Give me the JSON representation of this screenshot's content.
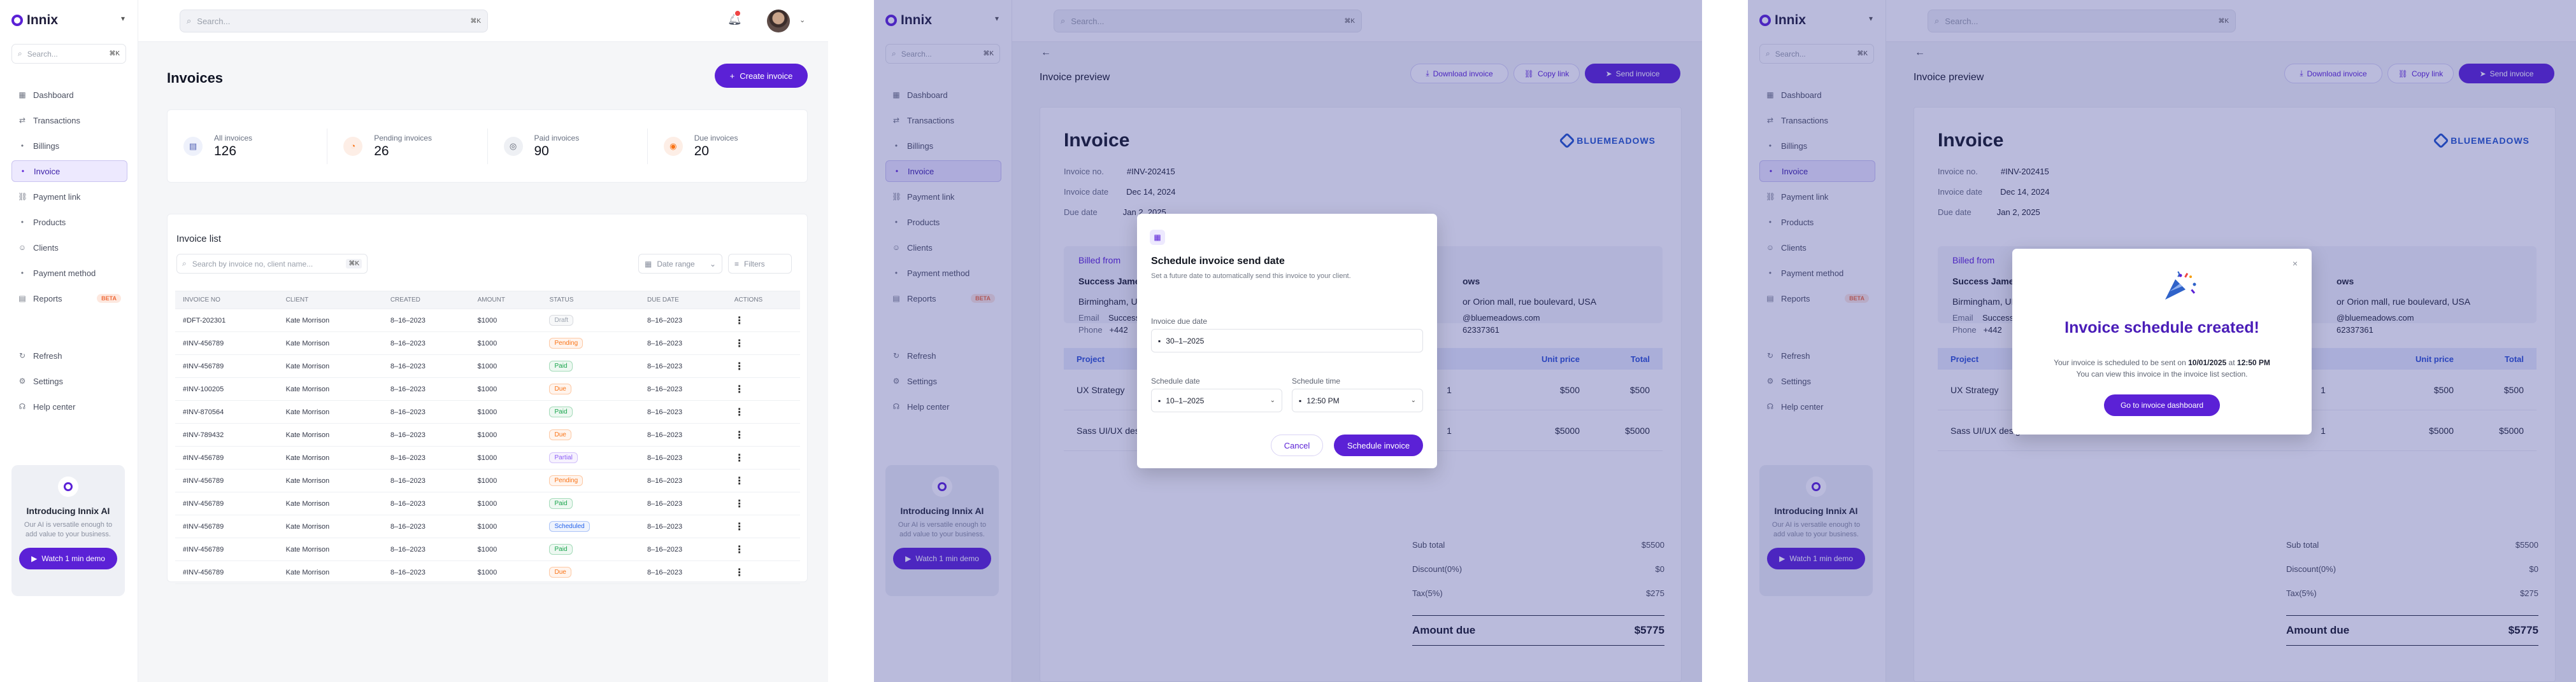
{
  "app": {
    "logo_text": "Innix",
    "search_placeholder": "Search...",
    "search_shortcut": "⌘K"
  },
  "sidebar": {
    "items": [
      {
        "label": "Dashboard",
        "icon": "dashboard-icon"
      },
      {
        "label": "Transactions",
        "icon": "transactions-icon"
      },
      {
        "label": "Billings",
        "icon": "billing-icon"
      },
      {
        "label": "Invoice",
        "icon": "invoice-icon",
        "active": true
      },
      {
        "label": "Payment link",
        "icon": "link-icon"
      },
      {
        "label": "Products",
        "icon": "products-icon"
      },
      {
        "label": "Clients",
        "icon": "clients-icon"
      },
      {
        "label": "Payment method",
        "icon": "payment-method-icon"
      },
      {
        "label": "Reports",
        "icon": "reports-icon",
        "badge": "BETA"
      }
    ],
    "bottom": [
      {
        "label": "Refresh",
        "icon": "refresh-icon"
      },
      {
        "label": "Settings",
        "icon": "settings-icon"
      },
      {
        "label": "Help center",
        "icon": "help-icon"
      }
    ],
    "promo": {
      "title": "Introducing Innix AI",
      "text": "Our AI is versatile enough to add value to your business.",
      "button": "Watch 1 min demo"
    }
  },
  "invoices_page": {
    "title": "Invoices",
    "create_button": "Create invoice",
    "stats": [
      {
        "label": "All invoices",
        "value": "126",
        "icon": "file-icon"
      },
      {
        "label": "Pending invoices",
        "value": "26",
        "icon": "pending-icon"
      },
      {
        "label": "Paid invoices",
        "value": "90",
        "icon": "paid-icon"
      },
      {
        "label": "Due invoices",
        "value": "20",
        "icon": "due-icon"
      }
    ],
    "list_title": "Invoice list",
    "list_search_placeholder": "Search by invoice no, client name...",
    "list_search_shortcut": "⌘K",
    "date_range": "Date range",
    "filters": "Filters",
    "columns": [
      "INVOICE NO",
      "CLIENT",
      "CREATED",
      "AMOUNT",
      "STATUS",
      "DUE DATE",
      "ACTIONS"
    ],
    "rows": [
      {
        "no": "#DFT-202301",
        "client": "Kate Morrison",
        "created": "8–16–2023",
        "amount": "$1000",
        "status": "Draft",
        "due": "8–16–2023"
      },
      {
        "no": "#INV-456789",
        "client": "Kate Morrison",
        "created": "8–16–2023",
        "amount": "$1000",
        "status": "Pending",
        "due": "8–16–2023"
      },
      {
        "no": "#INV-456789",
        "client": "Kate Morrison",
        "created": "8–16–2023",
        "amount": "$1000",
        "status": "Paid",
        "due": "8–16–2023"
      },
      {
        "no": "#INV-100205",
        "client": "Kate Morrison",
        "created": "8–16–2023",
        "amount": "$1000",
        "status": "Due",
        "due": "8–16–2023"
      },
      {
        "no": "#INV-870564",
        "client": "Kate Morrison",
        "created": "8–16–2023",
        "amount": "$1000",
        "status": "Paid",
        "due": "8–16–2023"
      },
      {
        "no": "#INV-789432",
        "client": "Kate Morrison",
        "created": "8–16–2023",
        "amount": "$1000",
        "status": "Due",
        "due": "8–16–2023"
      },
      {
        "no": "#INV-456789",
        "client": "Kate Morrison",
        "created": "8–16–2023",
        "amount": "$1000",
        "status": "Partial",
        "due": "8–16–2023"
      },
      {
        "no": "#INV-456789",
        "client": "Kate Morrison",
        "created": "8–16–2023",
        "amount": "$1000",
        "status": "Pending",
        "due": "8–16–2023"
      },
      {
        "no": "#INV-456789",
        "client": "Kate Morrison",
        "created": "8–16–2023",
        "amount": "$1000",
        "status": "Paid",
        "due": "8–16–2023"
      },
      {
        "no": "#INV-456789",
        "client": "Kate Morrison",
        "created": "8–16–2023",
        "amount": "$1000",
        "status": "Scheduled",
        "due": "8–16–2023"
      },
      {
        "no": "#INV-456789",
        "client": "Kate Morrison",
        "created": "8–16–2023",
        "amount": "$1000",
        "status": "Paid",
        "due": "8–16–2023"
      },
      {
        "no": "#INV-456789",
        "client": "Kate Morrison",
        "created": "8–16–2023",
        "amount": "$1000",
        "status": "Due",
        "due": "8–16–2023"
      }
    ],
    "status_colors": {
      "Draft": "#9ca3af",
      "Pending": "#f97316",
      "Paid": "#16a34a",
      "Due": "#f97316",
      "Partial": "#8b5cf6",
      "Scheduled": "#2563eb"
    }
  },
  "preview": {
    "title": "Invoice preview",
    "download": "Download invoice",
    "copy_link": "Copy link",
    "send": "Send invoice",
    "invoice_heading": "Invoice",
    "brand": "BLUEMEADOWS",
    "invoice_no_label": "Invoice no.",
    "invoice_no": "#INV-202415",
    "invoice_date_label": "Invoice date",
    "invoice_date": "Dec 14, 2024",
    "due_date_label": "Due date",
    "due_date": "Jan 2, 2025",
    "billed_from": "Billed from",
    "company": "Success James",
    "address": "Birmingham, UK",
    "email_label": "Email",
    "email": "Success",
    "phone_label": "Phone",
    "phone": "+442",
    "right_name": "ows",
    "right_address": "or Orion mall, rue boulevard, USA",
    "right_email": "@bluemeadows.com",
    "right_phone": "62337361",
    "columns": [
      "Project",
      "",
      "Unit price",
      "Total"
    ],
    "items": [
      {
        "project": "UX Strategy",
        "qty": "1",
        "price": "$500",
        "total": "$500"
      },
      {
        "project": "Sass UI/UX design",
        "qty": "1",
        "price": "$5000",
        "total": "$5000"
      }
    ],
    "subtotal_label": "Sub total",
    "subtotal": "$5500",
    "discount_label": "Discount(0%)",
    "discount": "$0",
    "tax_label": "Tax(5%)",
    "tax": "$275",
    "amount_due_label": "Amount due",
    "amount_due": "$5775"
  },
  "schedule_modal": {
    "title": "Schedule invoice send date",
    "subtitle": "Set a future date to automatically send this invoice to your client.",
    "due_label": "Invoice due date",
    "due_value": "30–1–2025",
    "date_label": "Schedule date",
    "date_value": "10–1–2025",
    "time_label": "Schedule time",
    "time_value": "12:50 PM",
    "cancel": "Cancel",
    "confirm": "Schedule invoice"
  },
  "success_modal": {
    "title": "Invoice schedule created!",
    "text_1": "Your invoice is scheduled to be sent on",
    "date": "10/01/2025",
    "text_2": "at",
    "time": "12:50 PM",
    "text_3": "You can view this invoice in the invoice list section.",
    "button": "Go to invoice dashboard",
    "close": "×"
  },
  "colors": {
    "accent": "#5b21d6",
    "overlay": "rgba(45,48,150,0.33)"
  }
}
